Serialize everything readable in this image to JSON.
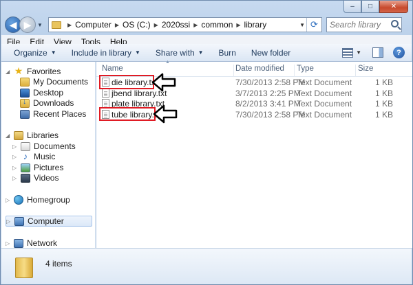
{
  "window": {
    "minimize_glyph": "–",
    "maximize_glyph": "□",
    "close_glyph": "✕"
  },
  "address": {
    "breadcrumbs": [
      "Computer",
      "OS (C:)",
      "2020ssi",
      "common",
      "library"
    ]
  },
  "search": {
    "placeholder": "Search library"
  },
  "menubar": [
    "File",
    "Edit",
    "View",
    "Tools",
    "Help"
  ],
  "toolbar": {
    "organize": "Organize",
    "include_in_library": "Include in library",
    "share_with": "Share with",
    "burn": "Burn",
    "new_folder": "New folder",
    "help": "?"
  },
  "nav": {
    "favorites": {
      "label": "Favorites",
      "items": [
        "My Documents",
        "Desktop",
        "Downloads",
        "Recent Places"
      ]
    },
    "libraries": {
      "label": "Libraries",
      "items": [
        "Documents",
        "Music",
        "Pictures",
        "Videos"
      ]
    },
    "homegroup": "Homegroup",
    "computer": "Computer",
    "network": "Network"
  },
  "columns": {
    "name": "Name",
    "date": "Date modified",
    "type": "Type",
    "size": "Size"
  },
  "files": [
    {
      "name": "die library.txt",
      "date": "7/30/2013 2:58 PM",
      "type": "Text Document",
      "size": "1 KB",
      "highlighted": true
    },
    {
      "name": "jbend library.txt",
      "date": "3/7/2013 2:25 PM",
      "type": "Text Document",
      "size": "1 KB",
      "highlighted": false
    },
    {
      "name": "plate library.txt",
      "date": "8/2/2013 3:41 PM",
      "type": "Text Document",
      "size": "1 KB",
      "highlighted": false
    },
    {
      "name": "tube library.txt",
      "date": "7/30/2013 2:58 PM",
      "type": "Text Document",
      "size": "1 KB",
      "highlighted": true
    }
  ],
  "status": {
    "item_count": "4 items"
  },
  "colors": {
    "highlight_box": "#e01b24",
    "arrow_stroke": "#000000"
  }
}
